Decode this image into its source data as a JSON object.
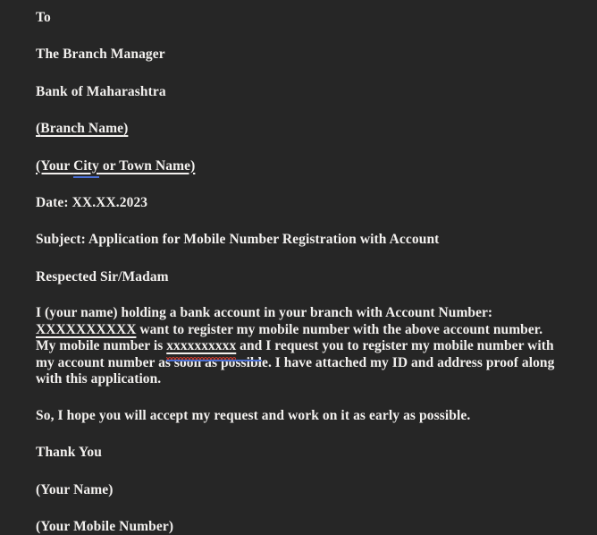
{
  "document": {
    "background_color": "#262626",
    "text_color": "#f2f0ee",
    "accent_blue": "#4a6fd4",
    "spellcheck_red": "#c0392b",
    "salutation_to": "To",
    "recipient_title": "The Branch Manager",
    "bank_name": "Bank of Maharashtra",
    "branch_placeholder_open": "(",
    "branch_placeholder_text": "Branch Name",
    "branch_placeholder_close": ")",
    "city_line_open": "(Your ",
    "city_word": "City",
    "city_line_rest": " or Town Name)",
    "date_line": "Date: XX.XX.2023",
    "subject_line": "Subject: Application for Mobile Number Registration with Account",
    "respected_line": "Respected Sir/Madam",
    "body": {
      "part1": "I (your name) holding a bank account in your branch with Account Number: ",
      "account_number_mask": "XXXXXXXXXX",
      "part2": " want to register my mobile number with the above account number. My mobile number is ",
      "mobile_number_mask": "xxxxxxxxxx",
      "part3_linked": " and",
      "part4": " I request you to register my mobile number with my account number as soon as possible. I have attached my ID and address proof along with this application."
    },
    "closing_request": "So, I hope you will accept my request and work on it as early as possible.",
    "thanks": "Thank You",
    "sender_name_placeholder": "(Your Name)",
    "sender_mobile_placeholder": "(Your Mobile Number)"
  }
}
